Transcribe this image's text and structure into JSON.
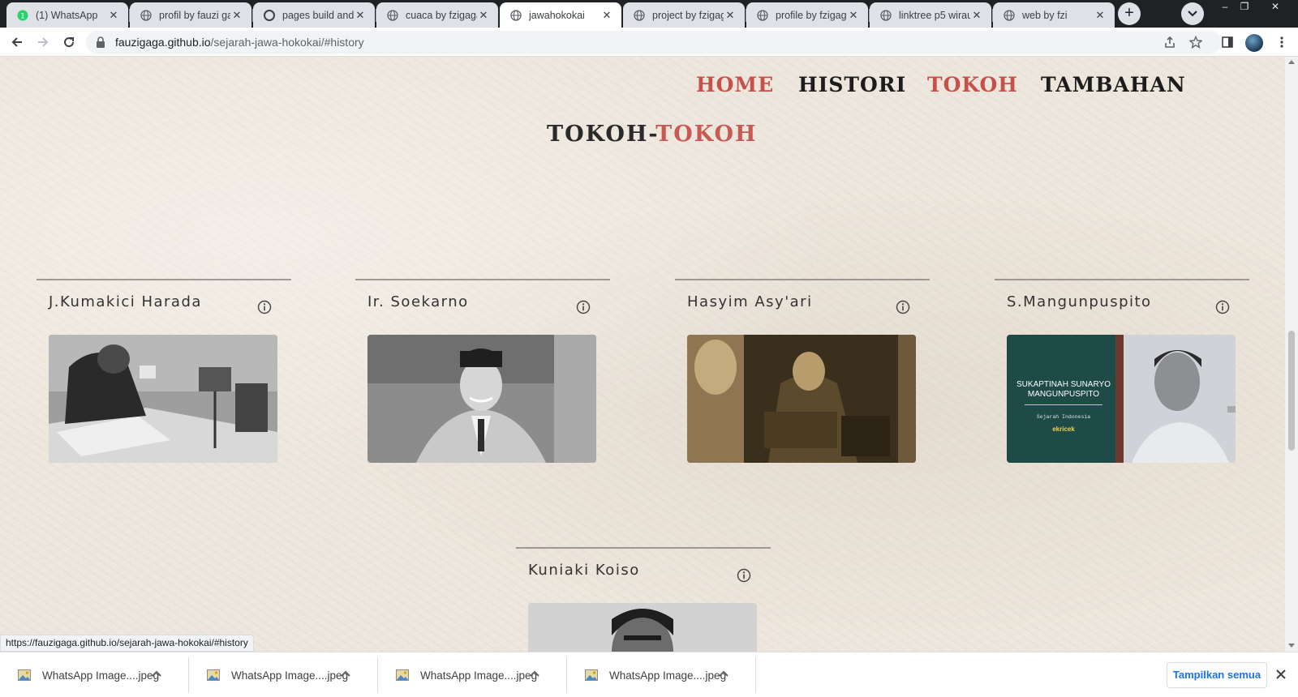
{
  "browser": {
    "tabs": [
      {
        "title": "(1) WhatsApp",
        "icon": "whatsapp-icon",
        "active": false
      },
      {
        "title": "profil by fauzi ga",
        "icon": "globe-icon",
        "active": false
      },
      {
        "title": "pages build and",
        "icon": "github-icon",
        "active": false
      },
      {
        "title": "cuaca by fzigaga",
        "icon": "globe-icon",
        "active": false
      },
      {
        "title": "jawahokokai",
        "icon": "globe-icon",
        "active": true
      },
      {
        "title": "project by fzigag",
        "icon": "globe-icon",
        "active": false
      },
      {
        "title": "profile by fzigag",
        "icon": "globe-icon",
        "active": false
      },
      {
        "title": "linktree p5 wirau",
        "icon": "globe-icon",
        "active": false
      },
      {
        "title": "web by fzi",
        "icon": "globe-icon",
        "active": false
      }
    ],
    "address": {
      "host": "fauzigaga.github.io",
      "path": "/sejarah-jawa-hokokai/#history"
    },
    "status_url": "https://fauzigaga.github.io/sejarah-jawa-hokokai/#history"
  },
  "page": {
    "nav": [
      {
        "label": "HOME",
        "color": "#c8504a"
      },
      {
        "label": "HISTORI",
        "color": "#1c1c1c"
      },
      {
        "label": "TOKOH",
        "color": "#c8504a"
      },
      {
        "label": "TAMBAHAN",
        "color": "#1c1c1c"
      }
    ],
    "section_title_part1": "TOKOH-",
    "section_title_part2": "TOKOH",
    "figures": [
      {
        "name": "J.Kumakici Harada"
      },
      {
        "name": "Ir. Soekarno"
      },
      {
        "name": "Hasyim Asy'ari"
      },
      {
        "name": "S.Mangunpuspito",
        "book_title": "SUKAPTINAH SUNARYO MANGUNPUSPITO",
        "book_subtitle": "Sejarah Indonesia",
        "book_brand": "ekricek"
      },
      {
        "name": "Kuniaki Koiso"
      }
    ]
  },
  "downloads": {
    "items": [
      {
        "name": "WhatsApp Image....jpeg"
      },
      {
        "name": "WhatsApp Image....jpeg"
      },
      {
        "name": "WhatsApp Image....jpeg"
      },
      {
        "name": "WhatsApp Image....jpeg"
      }
    ],
    "show_all_label": "Tampilkan semua"
  },
  "colors": {
    "accent": "#c8504a",
    "paper": "#ede6dc",
    "link_blue": "#1a73e8"
  }
}
